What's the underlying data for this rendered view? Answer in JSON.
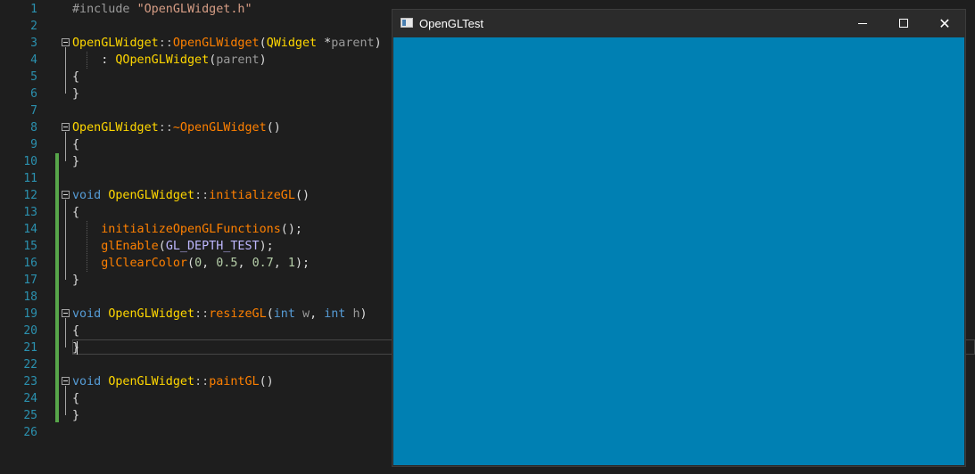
{
  "editor": {
    "line_numbers": [
      "1",
      "2",
      "3",
      "4",
      "5",
      "6",
      "7",
      "8",
      "9",
      "10",
      "11",
      "12",
      "13",
      "14",
      "15",
      "16",
      "17",
      "18",
      "19",
      "20",
      "21",
      "22",
      "23",
      "24",
      "25",
      "26"
    ],
    "lines": [
      [
        {
          "t": "#include ",
          "c": "pre"
        },
        {
          "t": "\"OpenGLWidget.h\"",
          "c": "str"
        }
      ],
      [],
      [
        {
          "t": "OpenGLWidget",
          "c": "fn"
        },
        {
          "t": "::",
          "c": "op"
        },
        {
          "t": "OpenGLWidget",
          "c": "ctor"
        },
        {
          "t": "(",
          "c": ""
        },
        {
          "t": "QWidget",
          "c": "fn"
        },
        {
          "t": " *",
          "c": ""
        },
        {
          "t": "parent",
          "c": "param"
        },
        {
          "t": ")",
          "c": ""
        }
      ],
      [
        {
          "t": "    : ",
          "c": ""
        },
        {
          "t": "QOpenGLWidget",
          "c": "fn"
        },
        {
          "t": "(",
          "c": ""
        },
        {
          "t": "parent",
          "c": "param"
        },
        {
          "t": ")",
          "c": ""
        }
      ],
      [
        {
          "t": "{",
          "c": ""
        }
      ],
      [
        {
          "t": "}",
          "c": ""
        }
      ],
      [],
      [
        {
          "t": "OpenGLWidget",
          "c": "fn"
        },
        {
          "t": "::",
          "c": "op"
        },
        {
          "t": "~OpenGLWidget",
          "c": "ctor"
        },
        {
          "t": "()",
          "c": ""
        }
      ],
      [
        {
          "t": "{",
          "c": ""
        }
      ],
      [
        {
          "t": "}",
          "c": ""
        }
      ],
      [],
      [
        {
          "t": "void",
          "c": "kw"
        },
        {
          "t": " ",
          "c": ""
        },
        {
          "t": "OpenGLWidget",
          "c": "fn"
        },
        {
          "t": "::",
          "c": "op"
        },
        {
          "t": "initializeGL",
          "c": "call"
        },
        {
          "t": "()",
          "c": ""
        }
      ],
      [
        {
          "t": "{",
          "c": ""
        }
      ],
      [
        {
          "t": "    ",
          "c": ""
        },
        {
          "t": "initializeOpenGLFunctions",
          "c": "call"
        },
        {
          "t": "();",
          "c": ""
        }
      ],
      [
        {
          "t": "    ",
          "c": ""
        },
        {
          "t": "glEnable",
          "c": "call"
        },
        {
          "t": "(",
          "c": ""
        },
        {
          "t": "GL_DEPTH_TEST",
          "c": "macro"
        },
        {
          "t": ");",
          "c": ""
        }
      ],
      [
        {
          "t": "    ",
          "c": ""
        },
        {
          "t": "glClearColor",
          "c": "call"
        },
        {
          "t": "(",
          "c": ""
        },
        {
          "t": "0",
          "c": "num"
        },
        {
          "t": ", ",
          "c": ""
        },
        {
          "t": "0.5",
          "c": "num"
        },
        {
          "t": ", ",
          "c": ""
        },
        {
          "t": "0.7",
          "c": "num"
        },
        {
          "t": ", ",
          "c": ""
        },
        {
          "t": "1",
          "c": "num"
        },
        {
          "t": ");",
          "c": ""
        }
      ],
      [
        {
          "t": "}",
          "c": ""
        }
      ],
      [],
      [
        {
          "t": "void",
          "c": "kw"
        },
        {
          "t": " ",
          "c": ""
        },
        {
          "t": "OpenGLWidget",
          "c": "fn"
        },
        {
          "t": "::",
          "c": "op"
        },
        {
          "t": "resizeGL",
          "c": "call"
        },
        {
          "t": "(",
          "c": ""
        },
        {
          "t": "int",
          "c": "kw"
        },
        {
          "t": " ",
          "c": ""
        },
        {
          "t": "w",
          "c": "param"
        },
        {
          "t": ", ",
          "c": ""
        },
        {
          "t": "int",
          "c": "kw"
        },
        {
          "t": " ",
          "c": ""
        },
        {
          "t": "h",
          "c": "param"
        },
        {
          "t": ")",
          "c": ""
        }
      ],
      [
        {
          "t": "{",
          "c": ""
        }
      ],
      [
        {
          "t": "}",
          "c": ""
        }
      ],
      [],
      [
        {
          "t": "void",
          "c": "kw"
        },
        {
          "t": " ",
          "c": ""
        },
        {
          "t": "OpenGLWidget",
          "c": "fn"
        },
        {
          "t": "::",
          "c": "op"
        },
        {
          "t": "paintGL",
          "c": "call"
        },
        {
          "t": "()",
          "c": ""
        }
      ],
      [
        {
          "t": "{",
          "c": ""
        }
      ],
      [
        {
          "t": "}",
          "c": ""
        }
      ],
      []
    ]
  },
  "window": {
    "title": "OpenGLTest",
    "app_icon": "window-app-icon",
    "controls": {
      "minimize": "minimize-icon",
      "maximize": "maximize-icon",
      "close": "close-icon",
      "close_glyph": "✕"
    },
    "clear_color_hex": "#0080b3"
  }
}
